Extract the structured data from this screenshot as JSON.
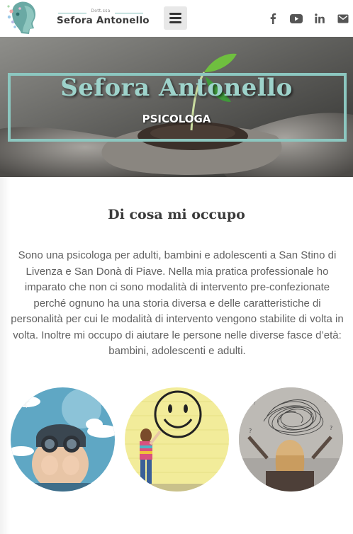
{
  "header": {
    "logo_small": "Dott.ssa",
    "logo_name": "Sefora Antonello",
    "menu_icon": "hamburger-menu-icon",
    "social": [
      "facebook-icon",
      "youtube-icon",
      "linkedin-icon",
      "email-icon"
    ]
  },
  "hero": {
    "title": "Sefora Antonello",
    "subtitle": "PSICOLOGA"
  },
  "about": {
    "heading": "Di cosa mi occupo",
    "text": "Sono una psicologa per adulti, bambini e adolescenti a San Stino di Livenza e San Donà di Piave. Nella mia pratica professionale ho imparato che non ci sono modalità di intervento pre-confezionate perché ognuno ha una storia diversa e delle caratteristiche di personalità per cui le modalità di intervento vengono stabilite di volta in volta. Inoltre mi occupo di aiutare le persone nelle diverse fasce d’età: bambini, adolescenti e adulti."
  },
  "colors": {
    "accent": "#8cc7c0",
    "title_teal": "#9ed3cb",
    "text": "#616161"
  }
}
